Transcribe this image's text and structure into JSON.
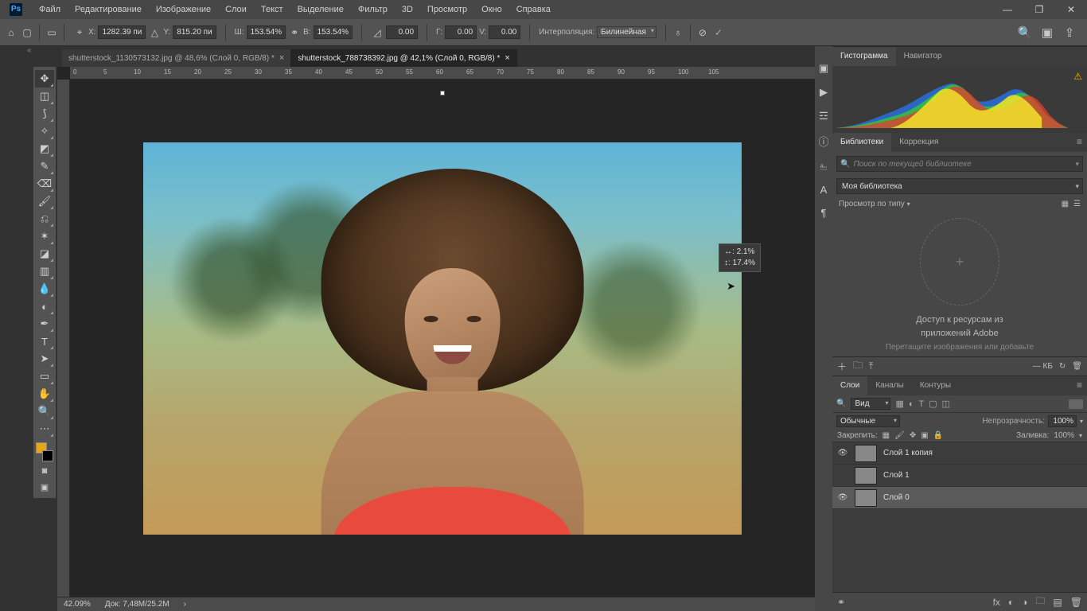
{
  "menu": {
    "items": [
      "Файл",
      "Редактирование",
      "Изображение",
      "Слои",
      "Текст",
      "Выделение",
      "Фильтр",
      "3D",
      "Просмотр",
      "Окно",
      "Справка"
    ]
  },
  "options": {
    "x_label": "X:",
    "x": "1282.39 пи",
    "y_label": "Y:",
    "y": "815.20 пи",
    "w_label": "Ш:",
    "w": "153.54%",
    "h_label": "В:",
    "h": "153.54%",
    "angle_label": "",
    "angle": "0.00",
    "hskew_label": "Г:",
    "hskew": "0.00",
    "vskew_label": "V:",
    "vskew": "0.00",
    "interp_label": "Интерполяция:",
    "interp_value": "Билинейная"
  },
  "tabs": [
    {
      "label": "shutterstock_1130573132.jpg @ 48,6% (Слой 0, RGB/8) *",
      "active": false
    },
    {
      "label": "shutterstock_788738392.jpg @ 42,1% (Слой 0, RGB/8) *",
      "active": true
    }
  ],
  "transform_tip": {
    "w": "↔:   2.1%",
    "h": "↕:  17.4%"
  },
  "status": {
    "zoom": "42.09%",
    "doc": "Док: 7,48M/25.2M"
  },
  "ruler_ticks": [
    "0",
    "5",
    "10",
    "15",
    "20",
    "25",
    "30",
    "35",
    "40",
    "45",
    "50",
    "55",
    "60",
    "65",
    "70",
    "75",
    "80",
    "85",
    "90",
    "95",
    "100",
    "105"
  ],
  "panel_histogram": {
    "tabs": [
      "Гистограмма",
      "Навигатор"
    ]
  },
  "panel_library": {
    "tabs": [
      "Библиотеки",
      "Коррекция"
    ],
    "search_placeholder": "Поиск по текущей библиотеке",
    "current": "Моя библиотека",
    "view": "Просмотр по типу",
    "msg1": "Доступ к ресурсам из",
    "msg2": "приложений Adobe",
    "msg3": "Перетащите изображения или добавьте",
    "kb": "— КБ"
  },
  "panel_layers": {
    "tabs": [
      "Слои",
      "Каналы",
      "Контуры"
    ],
    "kind": "Вид",
    "blend": "Обычные",
    "opacity_label": "Непрозрачность:",
    "opacity": "100%",
    "lock_label": "Закрепить:",
    "fill_label": "Заливка:",
    "fill": "100%",
    "layers": [
      {
        "name": "Слой 1 копия",
        "visible": true,
        "sel": false
      },
      {
        "name": "Слой 1",
        "visible": false,
        "sel": false
      },
      {
        "name": "Слой 0",
        "visible": true,
        "sel": true
      }
    ]
  }
}
